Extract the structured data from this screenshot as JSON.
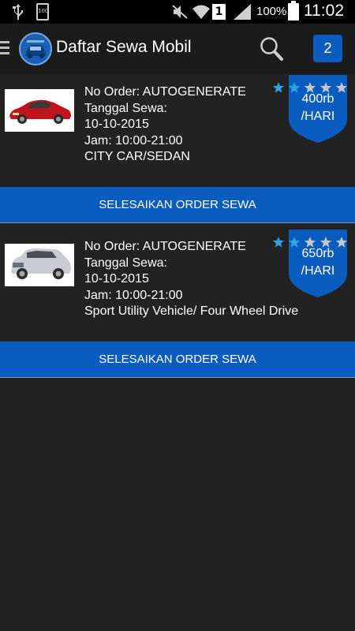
{
  "status_bar": {
    "battery_small_label": "100",
    "sim_label": "1",
    "battery_percent": "100%",
    "time": "11:02"
  },
  "header": {
    "title": "Daftar Sewa Mobil",
    "count": "2"
  },
  "orders": [
    {
      "order_no": "No Order: AUTOGENERATE",
      "date_label": "Tanggal Sewa:",
      "date": "10-10-2015",
      "time": "Jam: 10:00-21:00",
      "category": "CITY CAR/SEDAN",
      "price_line1": "400rb",
      "price_line2": "/HARI",
      "rating_filled": 2,
      "rating_total": 5,
      "action_label": "SELESAIKAN ORDER SEWA",
      "car_color": "#c0141d"
    },
    {
      "order_no": "No Order: AUTOGENERATE",
      "date_label": "Tanggal Sewa:",
      "date": "10-10-2015",
      "time": "Jam: 10:00-21:00",
      "category": "Sport Utility Vehicle/ Four Wheel Drive",
      "price_line1": "650rb",
      "price_line2": "/HARI",
      "rating_filled": 2,
      "rating_total": 5,
      "action_label": "SELESAIKAN ORDER SEWA",
      "car_color": "#c9ccd1"
    }
  ],
  "colors": {
    "accent": "#0b5cbf",
    "star_filled": "#2aa7e0",
    "star_empty": "#c7c7c7",
    "background": "#222222"
  }
}
